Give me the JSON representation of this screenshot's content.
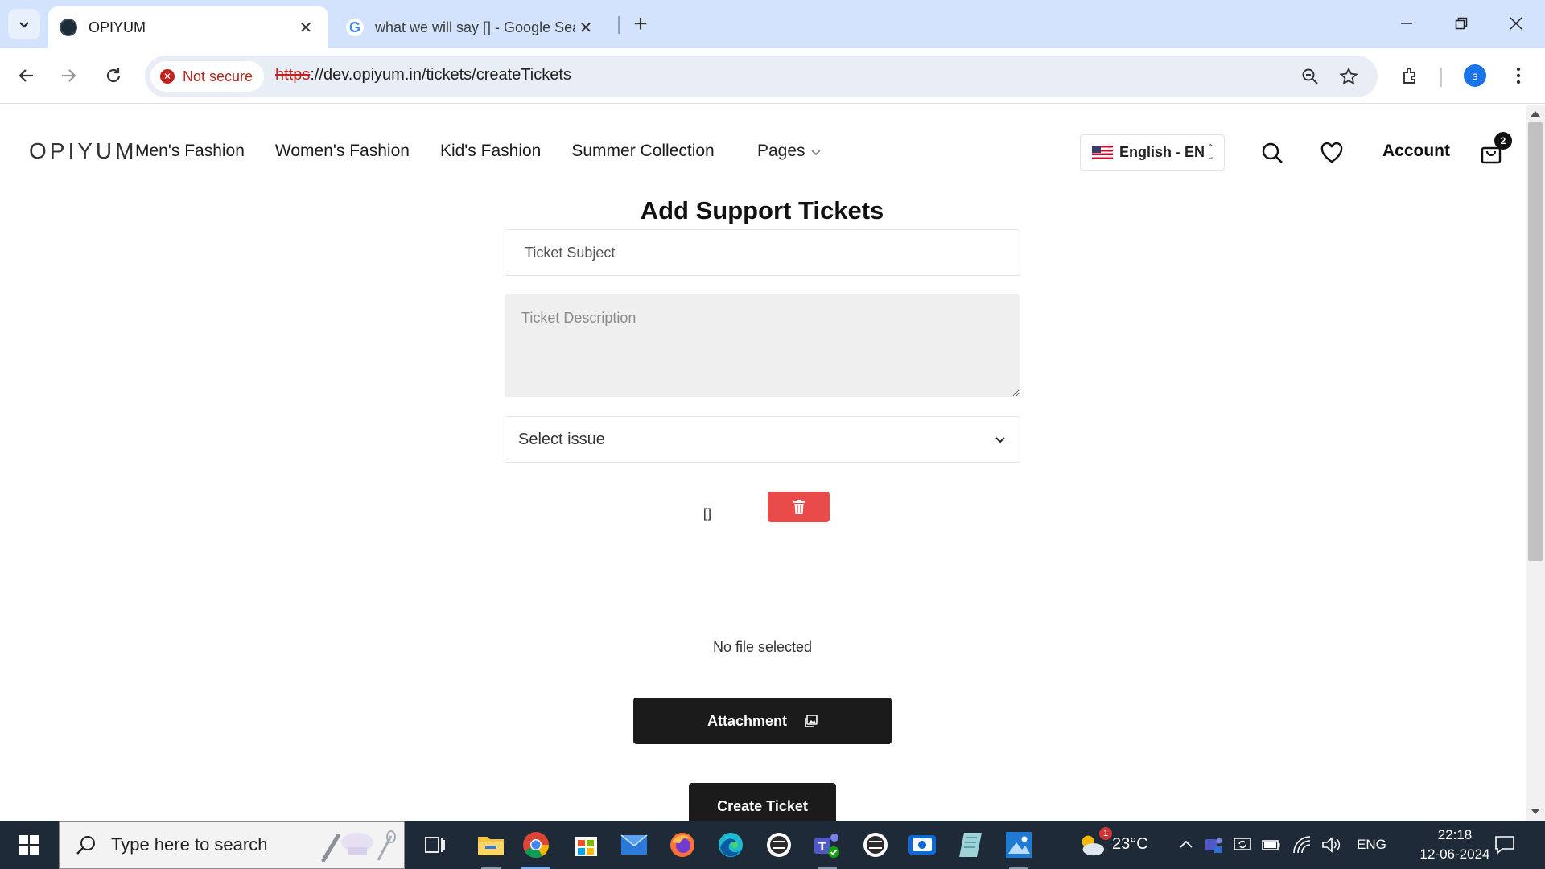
{
  "browser": {
    "tabs": [
      {
        "title": "OPIYUM",
        "active": true
      },
      {
        "title": "what we will say [] - Google Search",
        "active": false
      }
    ],
    "security_label": "Not secure",
    "url_scheme": "https",
    "url_rest": "://dev.opiyum.in/tickets/createTickets",
    "profile_initial": "s"
  },
  "site": {
    "logo": "OPIYUM",
    "nav": [
      "Men's Fashion",
      "Women's Fashion",
      "Kid's Fashion",
      "Summer Collection"
    ],
    "pages_label": "Pages",
    "language": "English - EN",
    "account_label": "Account",
    "cart_count": "2"
  },
  "form": {
    "title": "Add Support Tickets",
    "subject_placeholder": "Ticket Subject",
    "description_placeholder": "Ticket Description",
    "issue_selected": "Select issue",
    "brackets_text": "[]",
    "no_file_text": "No file selected",
    "attachment_label": "Attachment",
    "create_label": "Create Ticket"
  },
  "taskbar": {
    "search_placeholder": "Type here to search",
    "weather_temp": "23°C",
    "weather_badge": "1",
    "language": "ENG",
    "time": "22:18",
    "date": "12-06-2024"
  },
  "colors": {
    "delete_button": "#e94b4b",
    "primary_button": "#1b1b1b",
    "tabstrip": "#d3e3fd",
    "taskbar": "#1f2a38"
  }
}
